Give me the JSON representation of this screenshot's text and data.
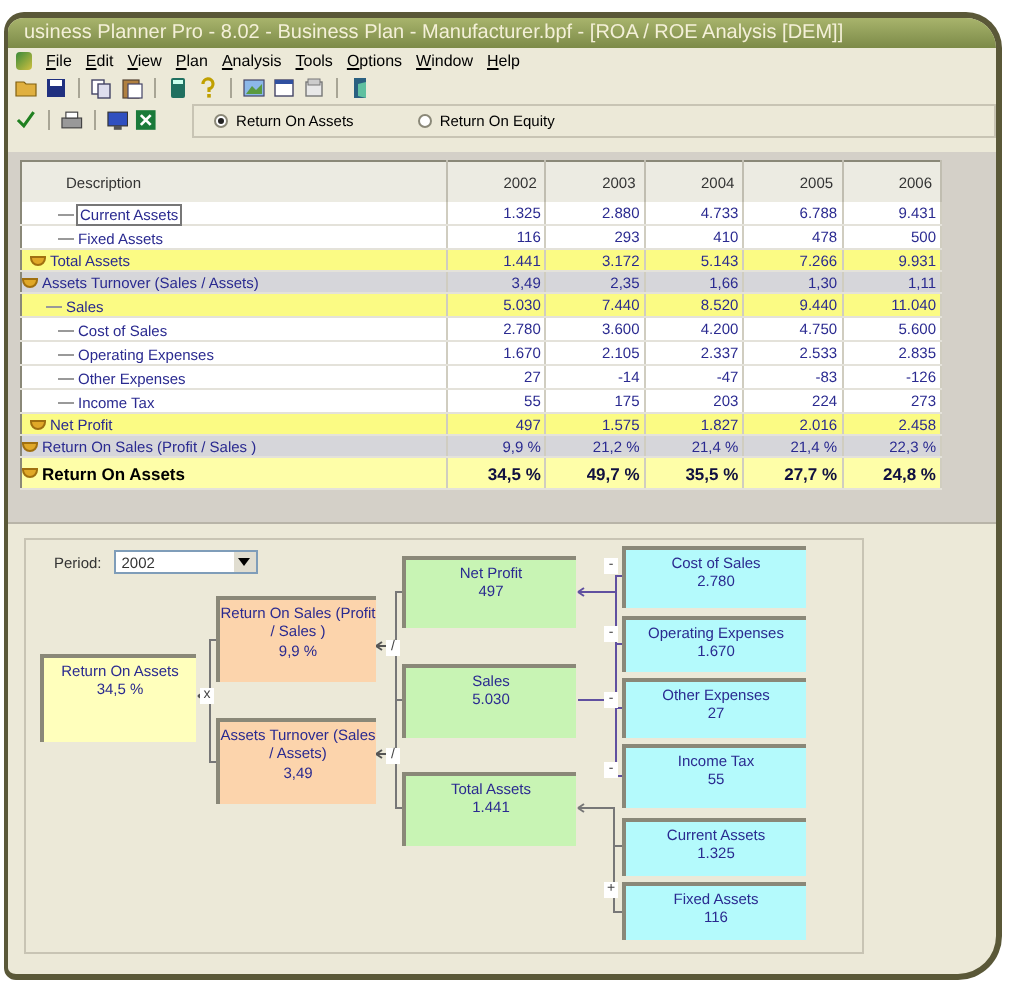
{
  "window": {
    "title": "usiness Planner Pro - 8.02 - Business Plan - Manufacturer.bpf - [ROA / ROE Analysis  [DEM]]"
  },
  "menu": [
    "File",
    "Edit",
    "View",
    "Plan",
    "Analysis",
    "Tools",
    "Options",
    "Window",
    "Help"
  ],
  "analysis_options": [
    {
      "label": "Return On Assets",
      "selected": true
    },
    {
      "label": "Return On Equity",
      "selected": false
    }
  ],
  "table": {
    "columns": [
      "Description",
      "2002",
      "2003",
      "2004",
      "2005",
      "2006"
    ],
    "rows": [
      {
        "kind": "item",
        "selected": true,
        "label": "Current Assets",
        "values": [
          "1.325",
          "2.880",
          "4.733",
          "6.788",
          "9.431"
        ]
      },
      {
        "kind": "item",
        "selected": false,
        "label": "Fixed Assets",
        "values": [
          "116",
          "293",
          "410",
          "478",
          "500"
        ]
      },
      {
        "kind": "total",
        "selected": false,
        "label": "Total Assets",
        "values": [
          "1.441",
          "3.172",
          "5.143",
          "7.266",
          "9.931"
        ]
      },
      {
        "kind": "ratio",
        "selected": false,
        "label": "Assets Turnover  (Sales / Assets)",
        "values": [
          "3,49",
          "2,35",
          "1,66",
          "1,30",
          "1,11"
        ]
      },
      {
        "kind": "subtotal",
        "selected": false,
        "label": "Sales",
        "values": [
          "5.030",
          "7.440",
          "8.520",
          "9.440",
          "11.040"
        ]
      },
      {
        "kind": "item",
        "selected": false,
        "label": "Cost of Sales",
        "values": [
          "2.780",
          "3.600",
          "4.200",
          "4.750",
          "5.600"
        ]
      },
      {
        "kind": "item",
        "selected": false,
        "label": "Operating Expenses",
        "values": [
          "1.670",
          "2.105",
          "2.337",
          "2.533",
          "2.835"
        ]
      },
      {
        "kind": "item",
        "selected": false,
        "label": "Other Expenses",
        "values": [
          "27",
          "-14",
          "-47",
          "-83",
          "-126"
        ]
      },
      {
        "kind": "item",
        "selected": false,
        "label": "Income Tax",
        "values": [
          "55",
          "175",
          "203",
          "224",
          "273"
        ]
      },
      {
        "kind": "total",
        "selected": false,
        "label": "Net Profit",
        "values": [
          "497",
          "1.575",
          "1.827",
          "2.016",
          "2.458"
        ]
      },
      {
        "kind": "ratio",
        "selected": false,
        "label": "Return On Sales  (Profit / Sales )",
        "values": [
          "9,9 %",
          "21,2 %",
          "21,4 %",
          "21,4 %",
          "22,3 %"
        ]
      },
      {
        "kind": "result",
        "selected": false,
        "label": "Return On Assets",
        "values": [
          "34,5 %",
          "49,7 %",
          "35,5 %",
          "27,7 %",
          "24,8 %"
        ]
      }
    ]
  },
  "period": {
    "label": "Period:",
    "value": "2002"
  },
  "diagram": {
    "nodes": [
      {
        "kind": "result",
        "label": "Return On Assets",
        "value": "34,5 %"
      },
      {
        "kind": "ratio",
        "label": "Return On Sales  (Profit / Sales )",
        "value": "9,9 %"
      },
      {
        "kind": "ratio",
        "label": "Assets Turnover (Sales / Assets)",
        "value": "3,49"
      },
      {
        "kind": "component",
        "label": "Net Profit",
        "value": "497"
      },
      {
        "kind": "component",
        "label": "Sales",
        "value": "5.030"
      },
      {
        "kind": "component",
        "label": "Total Assets",
        "value": "1.441"
      },
      {
        "kind": "item",
        "label": "Cost of Sales",
        "value": "2.780"
      },
      {
        "kind": "item",
        "label": "Operating Expenses",
        "value": "1.670"
      },
      {
        "kind": "item",
        "label": "Other Expenses",
        "value": "27"
      },
      {
        "kind": "item",
        "label": "Income Tax",
        "value": "55"
      },
      {
        "kind": "item",
        "label": "Current Assets",
        "value": "1.325"
      },
      {
        "kind": "item",
        "label": "Fixed Assets",
        "value": "116"
      }
    ],
    "operators": [
      "x",
      "/",
      "/",
      "-",
      "-",
      "-",
      "-",
      "+"
    ]
  }
}
